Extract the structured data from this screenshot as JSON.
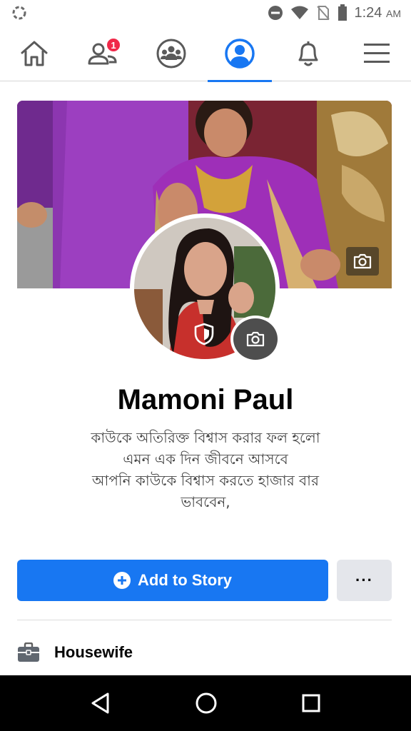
{
  "status_bar": {
    "time": "1:24",
    "ampm": "AM"
  },
  "nav": {
    "items": [
      {
        "name": "home",
        "icon": "home-icon"
      },
      {
        "name": "friends",
        "icon": "friends-icon",
        "badge": "1"
      },
      {
        "name": "groups",
        "icon": "groups-icon"
      },
      {
        "name": "profile",
        "icon": "profile-icon",
        "active": true
      },
      {
        "name": "notifications",
        "icon": "bell-icon"
      },
      {
        "name": "menu",
        "icon": "hamburger-menu-icon"
      }
    ]
  },
  "profile": {
    "name": "Mamoni Paul",
    "bio_lines": [
      "কাউকে অতিরিক্ত বিশ্বাস করার ফল হলো",
      "এমন এক দিন জীবনে আসবে",
      "আপনি কাউকে বিশ্বাস করতে হাজার বার",
      "ভাববেন,"
    ]
  },
  "actions": {
    "add_story_label": "Add to Story",
    "more_label": "···"
  },
  "details": {
    "work": "Housewife"
  },
  "colors": {
    "accent": "#1877f2",
    "badge": "#f02849",
    "secondary_button": "#e4e6eb"
  }
}
